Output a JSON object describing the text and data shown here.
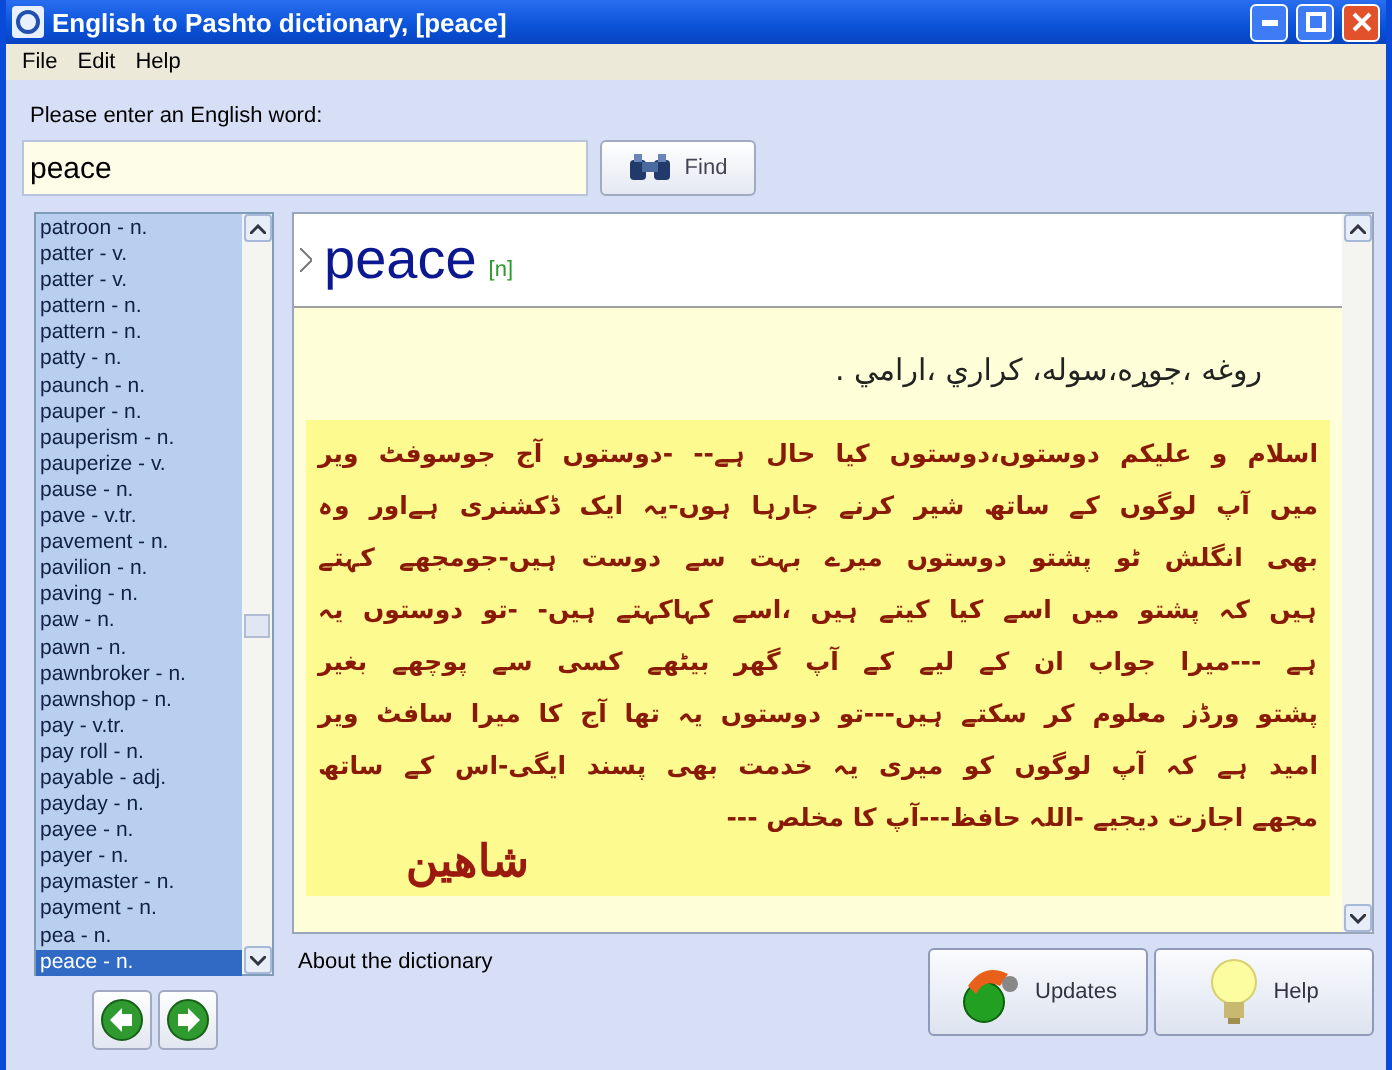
{
  "window": {
    "title": "English to Pashto dictionary, [peace]"
  },
  "menu": [
    "File",
    "Edit",
    "Help"
  ],
  "search": {
    "label": "Please enter an English word:",
    "value": "peace",
    "button": "Find"
  },
  "words": [
    {
      "text": "patroon  - n.",
      "selected": false
    },
    {
      "text": "patter  - v.",
      "selected": false
    },
    {
      "text": "patter  - v.",
      "selected": false
    },
    {
      "text": "pattern  - n.",
      "selected": false
    },
    {
      "text": "pattern  - n.",
      "selected": false
    },
    {
      "text": "patty  - n.",
      "selected": false
    },
    {
      "text": "paunch  - n.",
      "selected": false
    },
    {
      "text": "pauper  - n.",
      "selected": false
    },
    {
      "text": "pauperism  - n.",
      "selected": false
    },
    {
      "text": "pauperize  - v.",
      "selected": false
    },
    {
      "text": "pause  - n.",
      "selected": false
    },
    {
      "text": "pave  - v.tr.",
      "selected": false
    },
    {
      "text": "pavement  - n.",
      "selected": false
    },
    {
      "text": "pavilion  - n.",
      "selected": false
    },
    {
      "text": "paving  - n.",
      "selected": false
    },
    {
      "text": "paw  - n.",
      "selected": false
    },
    {
      "text": "pawn  - n.",
      "selected": false
    },
    {
      "text": "pawnbroker  - n.",
      "selected": false
    },
    {
      "text": "pawnshop  - n.",
      "selected": false
    },
    {
      "text": "pay  - v.tr.",
      "selected": false
    },
    {
      "text": "pay roll  - n.",
      "selected": false
    },
    {
      "text": "payable  - adj.",
      "selected": false
    },
    {
      "text": "payday  - n.",
      "selected": false
    },
    {
      "text": "payee  - n.",
      "selected": false
    },
    {
      "text": "payer  - n.",
      "selected": false
    },
    {
      "text": "paymaster  - n.",
      "selected": false
    },
    {
      "text": "payment  - n.",
      "selected": false
    },
    {
      "text": "pea  - n.",
      "selected": false
    },
    {
      "text": "peace  - n.",
      "selected": true
    }
  ],
  "entry": {
    "headword": "peace",
    "pos": "[n]",
    "translation": "روغه ،جوړه،سوله، کراري ،ارامي .",
    "note_lines": [
      "اسلام و علیکم دوستوں،دوستوں کیا حال ہے-- -دوستوں آج جوسوفٹ ویر",
      "میں آپ لوگوں کے ساتھ شیر کرنے جارہا ہوں-یہ ایک ڈکشنری ہےاور وہ",
      "بھی انگلش ٹو پشتو دوستوں میرے بہت سے دوست ہیں-جومجھے کہتے",
      "ہیں کہ پشتو میں اسے کیا کیتے ہیں ،اسے کہاکہتے ہیں- -تو دوستوں یہ",
      "ہے ---میرا جواب ان کے لیے کے آپ گھر بیٹھے کسی سے پوچھے بغیر",
      "پشتو ورڈز معلوم کر سکتے ہیں---تو دوستوں یہ تھا آج کا میرا سافٹ ویر",
      "امید ہے کہ آپ لوگوں کو میری یہ خدمت بھی پسند ایگی-اس کے ساتھ",
      "مجھے اجازت دیجیے -اللہ حافظ---آپ کا مخلص ---"
    ],
    "signature": "شاهين"
  },
  "about": "About the dictionary",
  "buttons": [
    {
      "kind": "updates",
      "label": "Updates"
    },
    {
      "kind": "help",
      "label": "Help"
    }
  ]
}
